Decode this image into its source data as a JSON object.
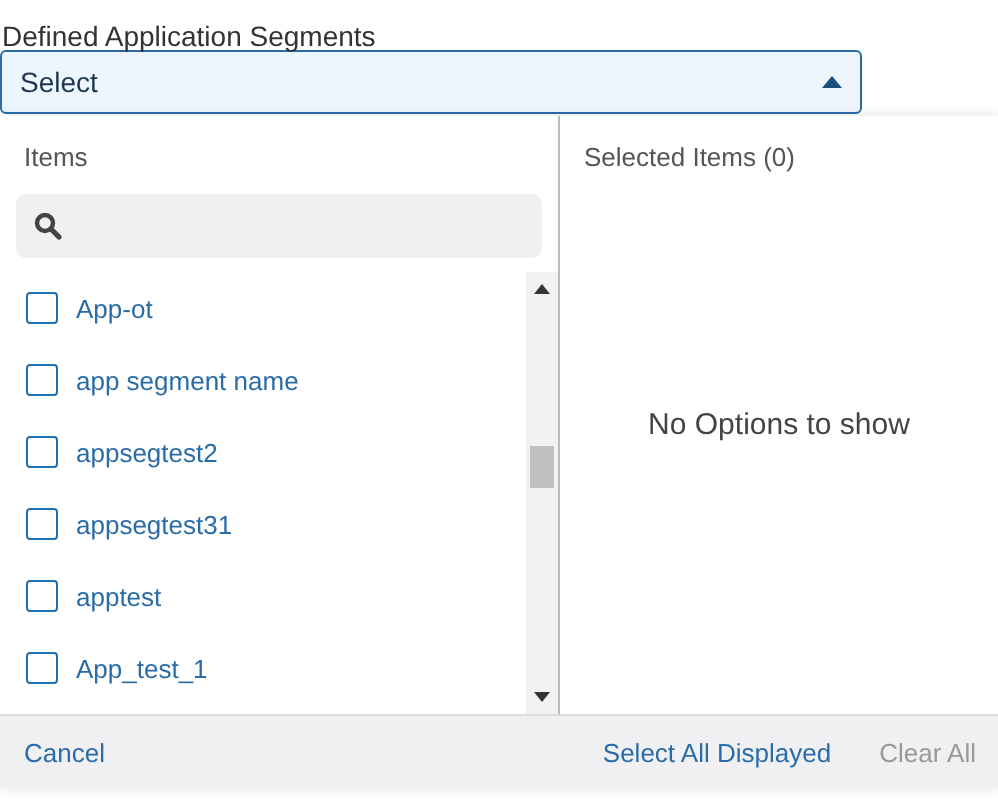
{
  "field_label": "Defined Application Segments",
  "dropdown": {
    "value": "Select",
    "expanded": true
  },
  "items_panel": {
    "title": "Items",
    "items": [
      {
        "label": "App-ot",
        "checked": false
      },
      {
        "label": "app segment name",
        "checked": false
      },
      {
        "label": "appsegtest2",
        "checked": false
      },
      {
        "label": "appsegtest31",
        "checked": false
      },
      {
        "label": "apptest",
        "checked": false
      },
      {
        "label": "App_test_1",
        "checked": false
      }
    ]
  },
  "selected_panel": {
    "title": "Selected Items (0)",
    "empty_message": "No Options to show"
  },
  "footer": {
    "cancel": "Cancel",
    "select_all": {
      "label": "Select All Displayed",
      "disabled": false
    },
    "clear_all": {
      "label": "Clear All",
      "disabled": true
    }
  }
}
